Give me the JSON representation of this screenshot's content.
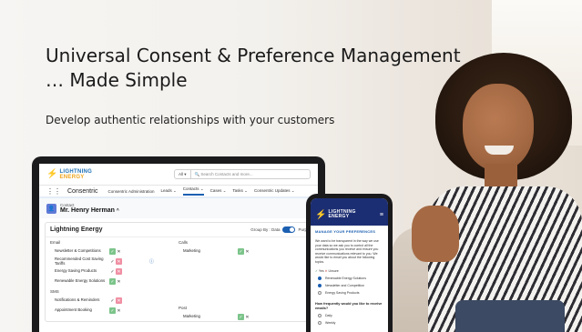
{
  "hero": {
    "headline_line1": "Universal Consent & Preference Management",
    "headline_line2": "… Made Simple",
    "subline": "Develop authentic relationships with your customers"
  },
  "laptop": {
    "brand": {
      "line1": "LIGHTNING",
      "line2": "ENERGY"
    },
    "search": {
      "scope": "All",
      "placeholder": "Search Contacts and more..."
    },
    "nav": {
      "app_name": "Consentric",
      "items": [
        "Consentric Administration",
        "Leads",
        "Contacts",
        "Cases",
        "Tasks",
        "Consentric Updates"
      ],
      "active_index": 2
    },
    "record": {
      "type": "Contact",
      "name": "Mr. Henry Herman"
    },
    "card": {
      "title": "Lightning Energy",
      "group_by": "Group By : Data",
      "group_by_alt": "Purp",
      "sections": [
        {
          "label": "Email",
          "rows": [
            {
              "label": "Newsletter & Competitions",
              "state": "yes"
            },
            {
              "label": "Recommended Cost Saving Tariffs",
              "state": "no"
            },
            {
              "label": "Energy Saving Products",
              "state": "no"
            },
            {
              "label": "Renewable Energy Solutions",
              "state": "yes"
            }
          ]
        },
        {
          "label": "Calls",
          "rows": [
            {
              "label": "Marketing",
              "state": "yes"
            }
          ]
        },
        {
          "label": "SMS",
          "rows": [
            {
              "label": "Notifications & Reminders",
              "state": "no"
            },
            {
              "label": "Appointment Booking",
              "state": "yes"
            }
          ]
        },
        {
          "label": "Post",
          "rows": [
            {
              "label": "Marketing",
              "state": "yes"
            }
          ]
        }
      ]
    }
  },
  "phone": {
    "brand": {
      "line1": "LIGHTNING",
      "line2": "ENERGY"
    },
    "heading": "MANAGE YOUR PREFERENCES",
    "copy": "We want to be transparent in the way we use your data so we ask you to control all the communications you receive and ensure you receive communications relevant to you. We would like to email you about the following topics.",
    "legend_yes": "Yes",
    "legend_no": "Unsure",
    "options": [
      {
        "label": "Renewable Energy Solutions",
        "selected": true
      },
      {
        "label": "Newsletter and Competition",
        "selected": true
      },
      {
        "label": "Energy Saving Products",
        "selected": false
      }
    ],
    "question": "How frequently would you like to receive emails?",
    "frequency": [
      {
        "label": "Daily",
        "selected": false
      },
      {
        "label": "Weekly",
        "selected": false
      }
    ]
  },
  "colors": {
    "brand_blue": "#1b5fb1",
    "brand_navy": "#1c2e73",
    "consent_green": "#7cc48a",
    "deny_pink": "#f08fa3",
    "bolt_orange": "#f0a51c"
  }
}
